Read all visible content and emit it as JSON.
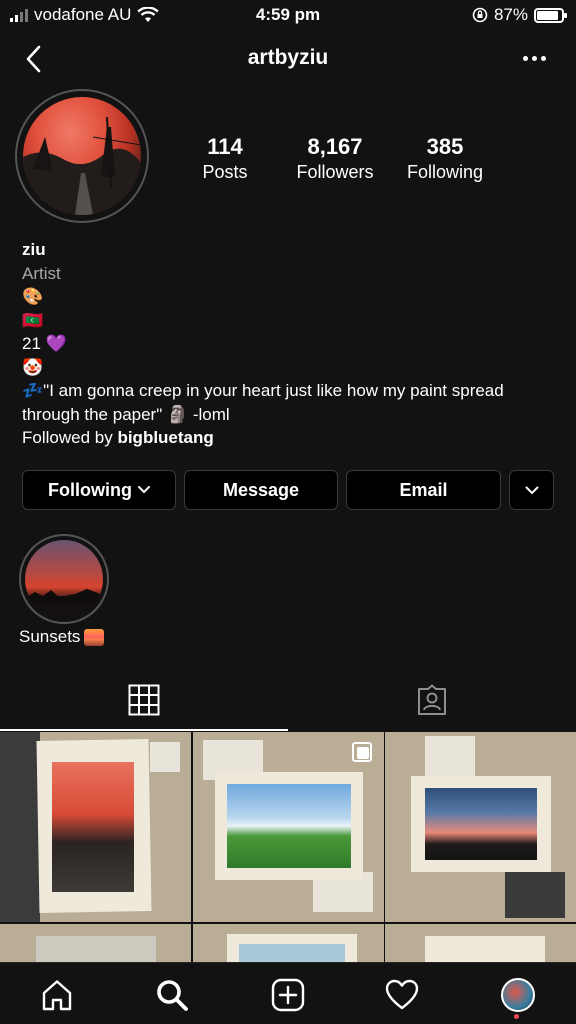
{
  "status_bar": {
    "carrier": "vodafone AU",
    "time": "4:59 pm",
    "battery_percent": "87%",
    "battery_level": 0.87
  },
  "header": {
    "username": "artbyziu",
    "back_icon": "chevron-left-icon",
    "more_icon": "more-horizontal-icon"
  },
  "profile": {
    "stats": [
      {
        "value": "114",
        "label": "Posts"
      },
      {
        "value": "8,167",
        "label": "Followers"
      },
      {
        "value": "385",
        "label": "Following"
      }
    ],
    "name": "ziu",
    "category": "Artist",
    "bio_lines": [
      "🎨",
      "🇲🇻",
      "21 💜",
      "🤡"
    ],
    "quote": "💤\"I am gonna creep in your heart just like how my paint spread through the paper\" 🗿 -loml",
    "followed_by_prefix": "Followed by",
    "followed_by_user": "bigbluetang"
  },
  "actions": {
    "following": "Following",
    "message": "Message",
    "email": "Email"
  },
  "highlights": [
    {
      "label": "Sunsets"
    }
  ],
  "tabs": {
    "grid_icon": "grid-icon",
    "tagged_icon": "tagged-user-icon",
    "active": "grid"
  },
  "nav": {
    "items": [
      "home-icon",
      "search-icon",
      "create-post-icon",
      "activity-heart-icon",
      "profile-avatar"
    ]
  },
  "colors": {
    "background": "#121212",
    "button_bg": "#000000",
    "button_border": "#3a3a3a",
    "secondary_text": "#a8a8a8",
    "notification_dot": "#ed4956"
  }
}
